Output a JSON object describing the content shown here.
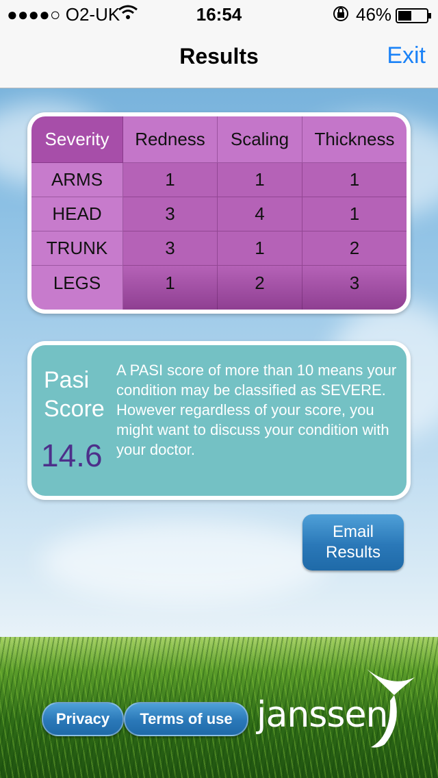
{
  "status_bar": {
    "carrier": "●●●●○ O2-UK",
    "time": "16:54",
    "battery": "46%"
  },
  "nav": {
    "title": "Results",
    "exit_label": "Exit"
  },
  "severity_table": {
    "headers": [
      "Severity",
      "Redness",
      "Scaling",
      "Thickness"
    ],
    "rows": [
      {
        "region": "ARMS",
        "redness": "1",
        "scaling": "1",
        "thickness": "1"
      },
      {
        "region": "HEAD",
        "redness": "3",
        "scaling": "4",
        "thickness": "1"
      },
      {
        "region": "TRUNK",
        "redness": "3",
        "scaling": "1",
        "thickness": "2"
      },
      {
        "region": "LEGS",
        "redness": "1",
        "scaling": "2",
        "thickness": "3"
      }
    ]
  },
  "score": {
    "label_line1": "Pasi",
    "label_line2": "Score",
    "value": "14.6",
    "description": "A PASI score of more than 10 means your condition may be classified as SEVERE. However regardless of your score, you might want to discuss your condition with your doctor."
  },
  "actions": {
    "email_line1": "Email",
    "email_line2": "Results"
  },
  "footer": {
    "privacy_label": "Privacy",
    "terms_label": "Terms of use",
    "brand": "janssen"
  },
  "colors": {
    "accent_blue": "#1a82f7",
    "table_purple": "#b562b7",
    "score_teal": "#74c1c4",
    "score_value": "#4d2f8a"
  },
  "icons": [
    "wifi-icon",
    "orientation-lock-icon",
    "battery-icon",
    "janssen-logo-mark"
  ]
}
